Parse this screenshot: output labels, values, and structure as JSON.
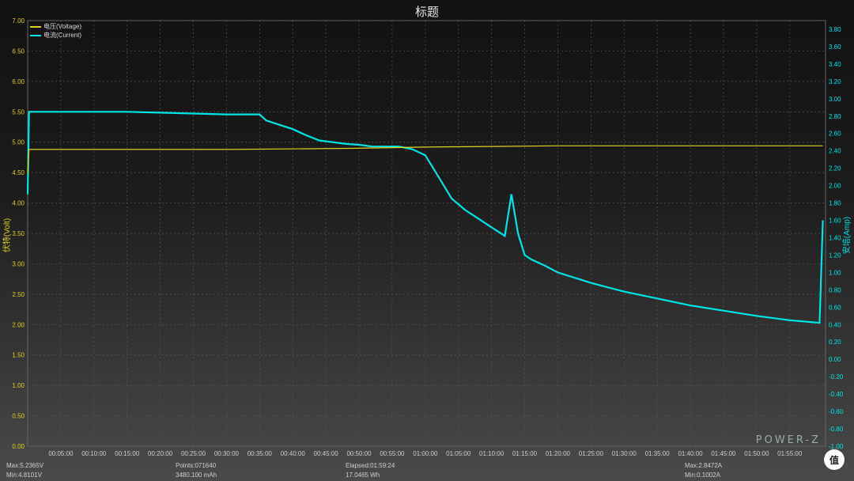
{
  "chart_data": {
    "type": "line",
    "title": "标题",
    "left_axis": {
      "label": "伏特(Volt)",
      "ylim": [
        0,
        7
      ],
      "ticks": [
        "0.00",
        "0.50",
        "1.00",
        "1.50",
        "2.00",
        "2.50",
        "3.00",
        "3.50",
        "4.00",
        "4.50",
        "5.00",
        "5.50",
        "6.00",
        "6.50",
        "7.00"
      ],
      "color": "#e0d020"
    },
    "right_axis": {
      "label": "安培(Amp)",
      "ylim": [
        -1,
        3.9
      ],
      "ticks": [
        "-1.00",
        "-0.80",
        "-0.60",
        "-0.40",
        "-0.20",
        "0.00",
        "0.20",
        "0.40",
        "0.60",
        "0.80",
        "1.00",
        "1.20",
        "1.40",
        "1.60",
        "1.80",
        "2.00",
        "2.20",
        "2.40",
        "2.60",
        "2.80",
        "3.00",
        "3.20",
        "3.40",
        "3.60",
        "3.80"
      ],
      "color": "#00e5e5"
    },
    "x_axis": {
      "xlim_minutes": [
        0,
        120.4
      ],
      "ticks": [
        "00:05:00",
        "00:10:00",
        "00:15:00",
        "00:20:00",
        "00:25:00",
        "00:30:00",
        "00:35:00",
        "00:40:00",
        "00:45:00",
        "00:50:00",
        "00:55:00",
        "01:00:00",
        "01:05:00",
        "01:10:00",
        "01:15:00",
        "01:20:00",
        "01:25:00",
        "01:30:00",
        "01:35:00",
        "01:40:00",
        "01:45:00",
        "01:50:00",
        "01:55:00"
      ]
    },
    "grid": true,
    "legend_position": "top-left",
    "series": [
      {
        "name": "电压(Voltage)",
        "axis": "left",
        "color": "#e0d020",
        "x": [
          0,
          0.2,
          10,
          20,
          30,
          40,
          50,
          55,
          60,
          70,
          80,
          90,
          100,
          110,
          120
        ],
        "y": [
          4.48,
          4.88,
          4.88,
          4.88,
          4.88,
          4.89,
          4.9,
          4.91,
          4.92,
          4.93,
          4.94,
          4.94,
          4.94,
          4.94,
          4.94
        ]
      },
      {
        "name": "电流(Current)",
        "axis": "right",
        "color": "#00e5e5",
        "x": [
          0,
          0.2,
          5,
          10,
          15,
          20,
          25,
          30,
          35,
          36,
          38,
          40,
          42,
          44,
          46,
          48,
          50,
          52,
          54,
          56,
          58,
          60,
          62,
          64,
          66,
          68,
          70,
          72,
          73,
          74,
          75,
          76,
          78,
          80,
          85,
          90,
          95,
          100,
          105,
          110,
          115,
          118,
          119.5,
          120
        ],
        "y": [
          1.9,
          2.85,
          2.85,
          2.85,
          2.85,
          2.84,
          2.83,
          2.82,
          2.82,
          2.75,
          2.7,
          2.65,
          2.58,
          2.52,
          2.5,
          2.48,
          2.47,
          2.45,
          2.45,
          2.45,
          2.42,
          2.35,
          2.1,
          1.85,
          1.72,
          1.62,
          1.52,
          1.42,
          1.9,
          1.45,
          1.2,
          1.15,
          1.08,
          1.0,
          0.88,
          0.78,
          0.7,
          0.62,
          0.56,
          0.5,
          0.45,
          0.43,
          0.42,
          1.6
        ]
      }
    ]
  },
  "footer": {
    "max_voltage": "Max:5.2365V",
    "min_voltage": "Min:4.8101V",
    "points": "Points:071640",
    "capacity": "3480.100 mAh",
    "elapsed": "Elapsed:01:59:24",
    "energy": "17.0465 Wh",
    "max_current": "Max:2.8472A",
    "min_current": "Min:0.1002A",
    "brand": "POWER-Z",
    "logo_letter": "值"
  }
}
